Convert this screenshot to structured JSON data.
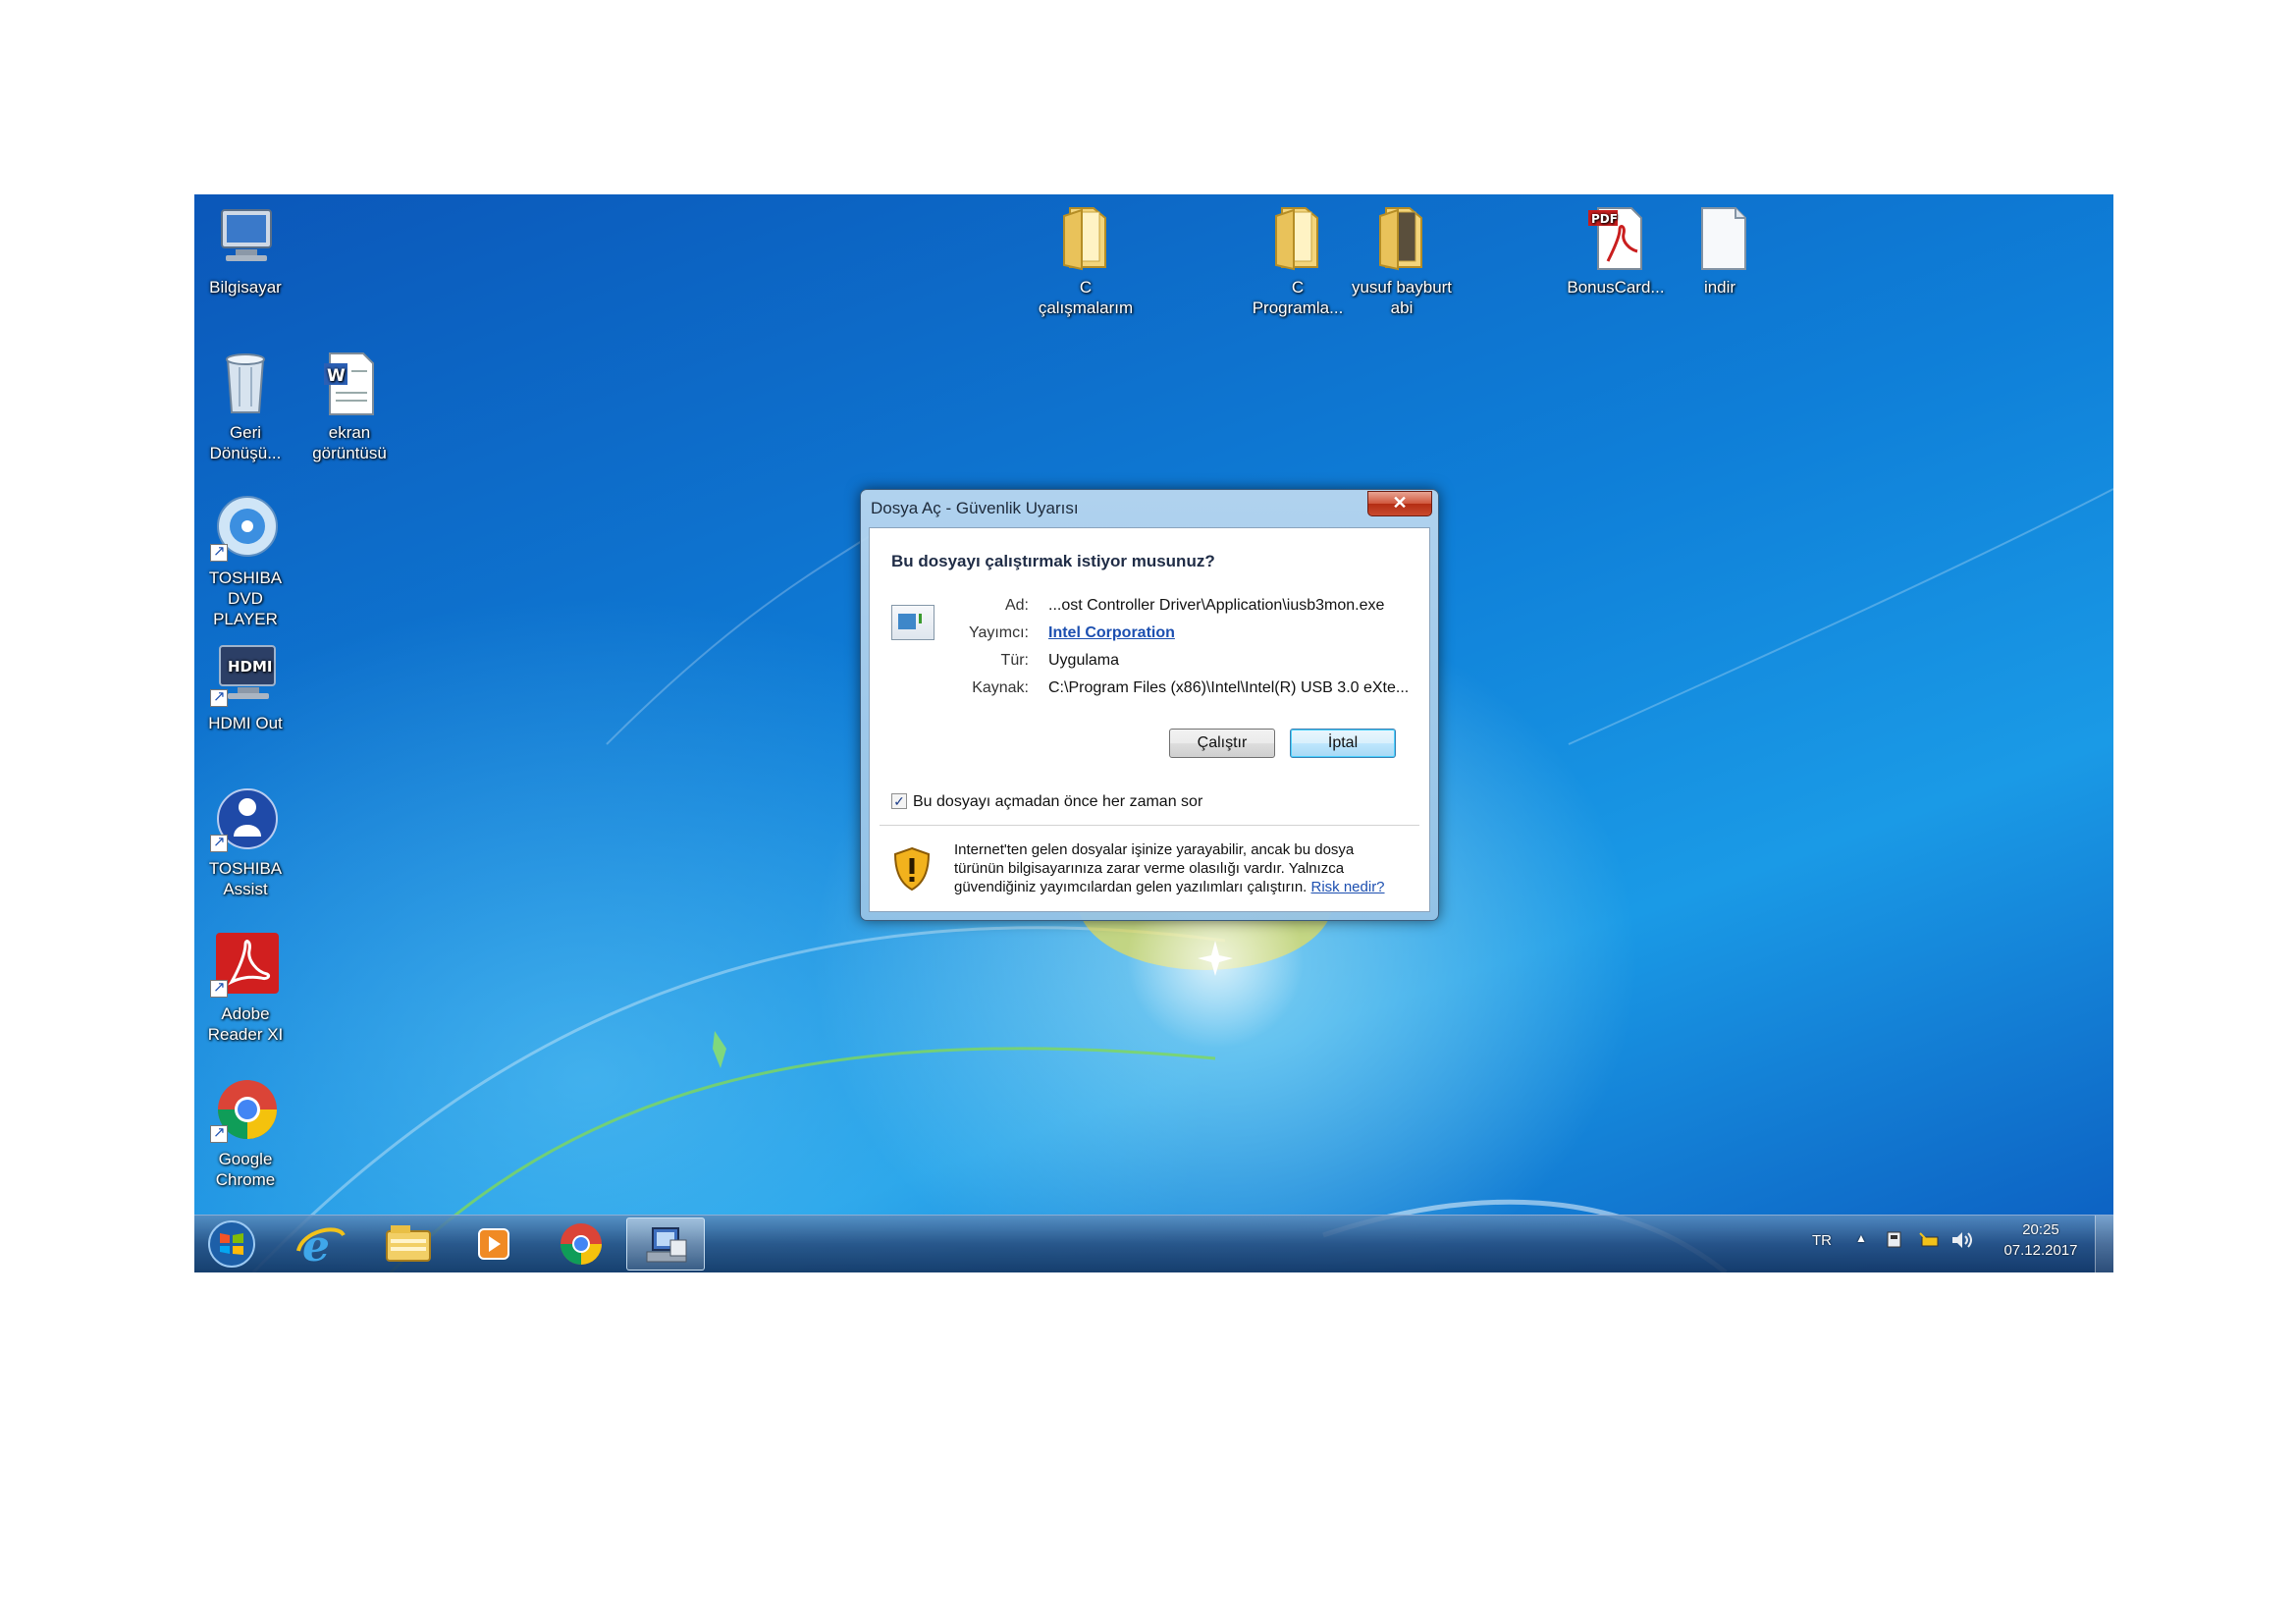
{
  "desktop": {
    "icons": [
      {
        "label": "Bilgisayar",
        "icon": "computer-icon"
      },
      {
        "label": "Geri Dönüşü...",
        "icon": "recycle-bin-icon"
      },
      {
        "label": "ekran görüntüsü",
        "icon": "word-document-icon"
      },
      {
        "label": "TOSHIBA DVD PLAYER",
        "icon": "dvd-player-icon"
      },
      {
        "label": "HDMI Out",
        "icon": "hdmi-icon"
      },
      {
        "label": "TOSHIBA Assist",
        "icon": "toshiba-assist-icon"
      },
      {
        "label": "Adobe Reader XI",
        "icon": "adobe-reader-icon"
      },
      {
        "label": "Google Chrome",
        "icon": "chrome-icon"
      },
      {
        "label": "C çalışmalarım",
        "icon": "folder-icon"
      },
      {
        "label": "C Programla...",
        "icon": "folder-icon"
      },
      {
        "label": "yusuf bayburt abi",
        "icon": "folder-icon"
      },
      {
        "label": "BonusCard...",
        "icon": "pdf-file-icon"
      },
      {
        "label": "indir",
        "icon": "blank-file-icon"
      }
    ]
  },
  "dialog": {
    "title": "Dosya Aç - Güvenlik Uyarısı",
    "close_glyph": "✕",
    "question": "Bu dosyayı çalıştırmak istiyor musunuz?",
    "fields": [
      {
        "label": "Ad:",
        "value": "...ost Controller Driver\\Application\\iusb3mon.exe"
      },
      {
        "label": "Yayımcı:",
        "value": "Intel Corporation"
      },
      {
        "label": "Tür:",
        "value": "Uygulama"
      },
      {
        "label": "Kaynak:",
        "value": "C:\\Program Files (x86)\\Intel\\Intel(R) USB 3.0 eXte..."
      }
    ],
    "run_button": "Çalıştır",
    "cancel_button": "İptal",
    "always_ask_label": "Bu dosyayı açmadan önce her zaman sor",
    "always_ask_checked": true,
    "warning_text": "Internet'ten gelen dosyalar işinize yarayabilir, ancak bu dosya türünün bilgisayarınıza zarar verme olasılığı vardır. Yalnızca güvendiğiniz yayımcılardan gelen yazılımları çalıştırın.",
    "risk_link": "Risk nedir?"
  },
  "taskbar": {
    "pinned": [
      {
        "icon": "start-orb-icon"
      },
      {
        "icon": "internet-explorer-icon"
      },
      {
        "icon": "file-explorer-icon"
      },
      {
        "icon": "media-player-icon"
      },
      {
        "icon": "chrome-icon"
      },
      {
        "icon": "security-warning-app-icon",
        "active": true
      }
    ],
    "language": "TR",
    "time": "20:25",
    "date": "07.12.2017"
  },
  "colors": {
    "desktop_blue": "#0f7fd8",
    "link_blue": "#1c4fb0",
    "close_red": "#c84a2f"
  }
}
